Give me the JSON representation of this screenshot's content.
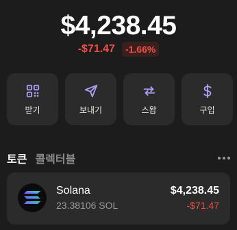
{
  "balance": "$4,238.45",
  "change": {
    "amount": "-$71.47",
    "percent": "-1.66%"
  },
  "colors": {
    "accent": "#ab9ff2",
    "negative": "#ef4f45",
    "background": "#1c1c1c",
    "card": "#2b2b2b"
  },
  "actions": [
    {
      "label": "받기",
      "icon": "qr-code-icon"
    },
    {
      "label": "보내기",
      "icon": "send-icon"
    },
    {
      "label": "스왑",
      "icon": "swap-icon"
    },
    {
      "label": "구입",
      "icon": "dollar-icon"
    }
  ],
  "tabs": [
    {
      "label": "토큰",
      "active": true
    },
    {
      "label": "콜렉터블",
      "active": false
    }
  ],
  "tokens": [
    {
      "name": "Solana",
      "amount": "23.38106 SOL",
      "value": "$4,238.45",
      "change": "-$71.47",
      "icon": "solana-logo-icon"
    }
  ]
}
